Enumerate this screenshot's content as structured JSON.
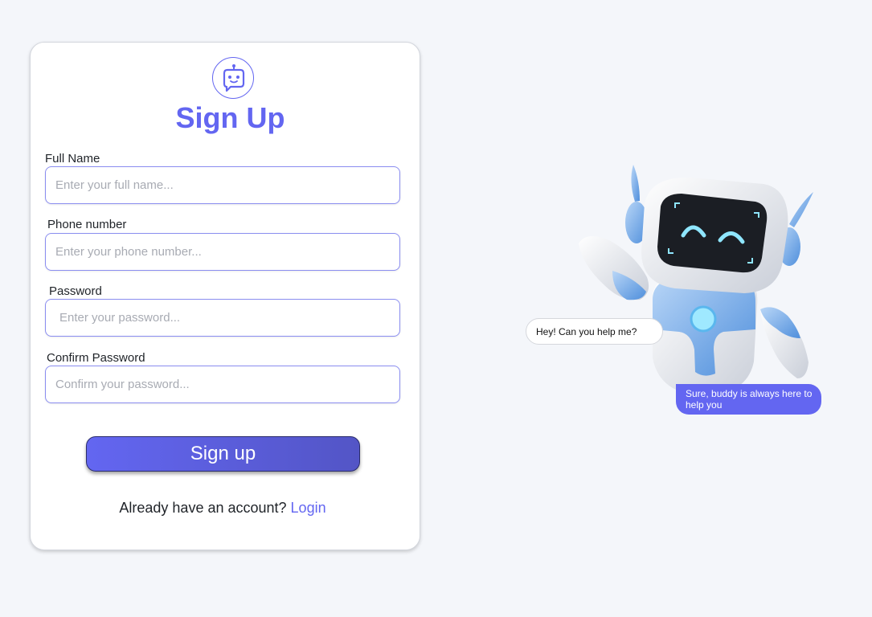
{
  "form": {
    "title": "Sign Up",
    "fields": [
      {
        "label": "Full Name",
        "placeholder": "Enter your full name...",
        "value": ""
      },
      {
        "label": "Phone number",
        "placeholder": "Enter your phone number...",
        "value": ""
      },
      {
        "label": "Password",
        "placeholder": "Enter your password...",
        "value": ""
      },
      {
        "label": "Confirm Password",
        "placeholder": "Confirm your password...",
        "value": ""
      }
    ],
    "submit_label": "Sign up",
    "account_prompt": "Already have an account? ",
    "login_label": "Login"
  },
  "chat": {
    "user_message": "Hey! Can you help me?",
    "bot_message": "Sure, buddy is always here to help you"
  },
  "icons": {
    "logo": "robot-chat-icon",
    "illustration": "robot-mascot-icon"
  },
  "colors": {
    "accent": "#6366f1",
    "background": "#f4f6fa"
  }
}
